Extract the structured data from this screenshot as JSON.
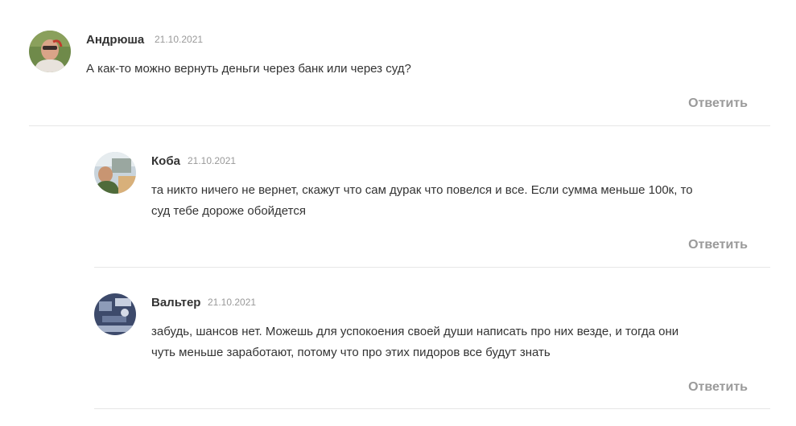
{
  "comments": [
    {
      "author": "Андрюша",
      "date": "21.10.2021",
      "text": "А как-то можно вернуть деньги через банк или через суд?",
      "reply_label": "Ответить",
      "avatar_icon": "user-photo-avatar"
    },
    {
      "author": "Коба",
      "date": "21.10.2021",
      "text": "та никто ничего не вернет, скажут что сам дурак что повелся и все. Если сумма меньше 100к, то суд тебе дороже обойдется",
      "reply_label": "Ответить",
      "avatar_icon": "user-photo-avatar"
    },
    {
      "author": "Вальтер",
      "date": "21.10.2021",
      "text": "забудь, шансов нет. Можешь для успокоения своей души написать про них везде, и тогда они чуть меньше заработают, потому что про этих пидоров все будут знать",
      "reply_label": "Ответить",
      "avatar_icon": "user-photo-avatar"
    }
  ]
}
